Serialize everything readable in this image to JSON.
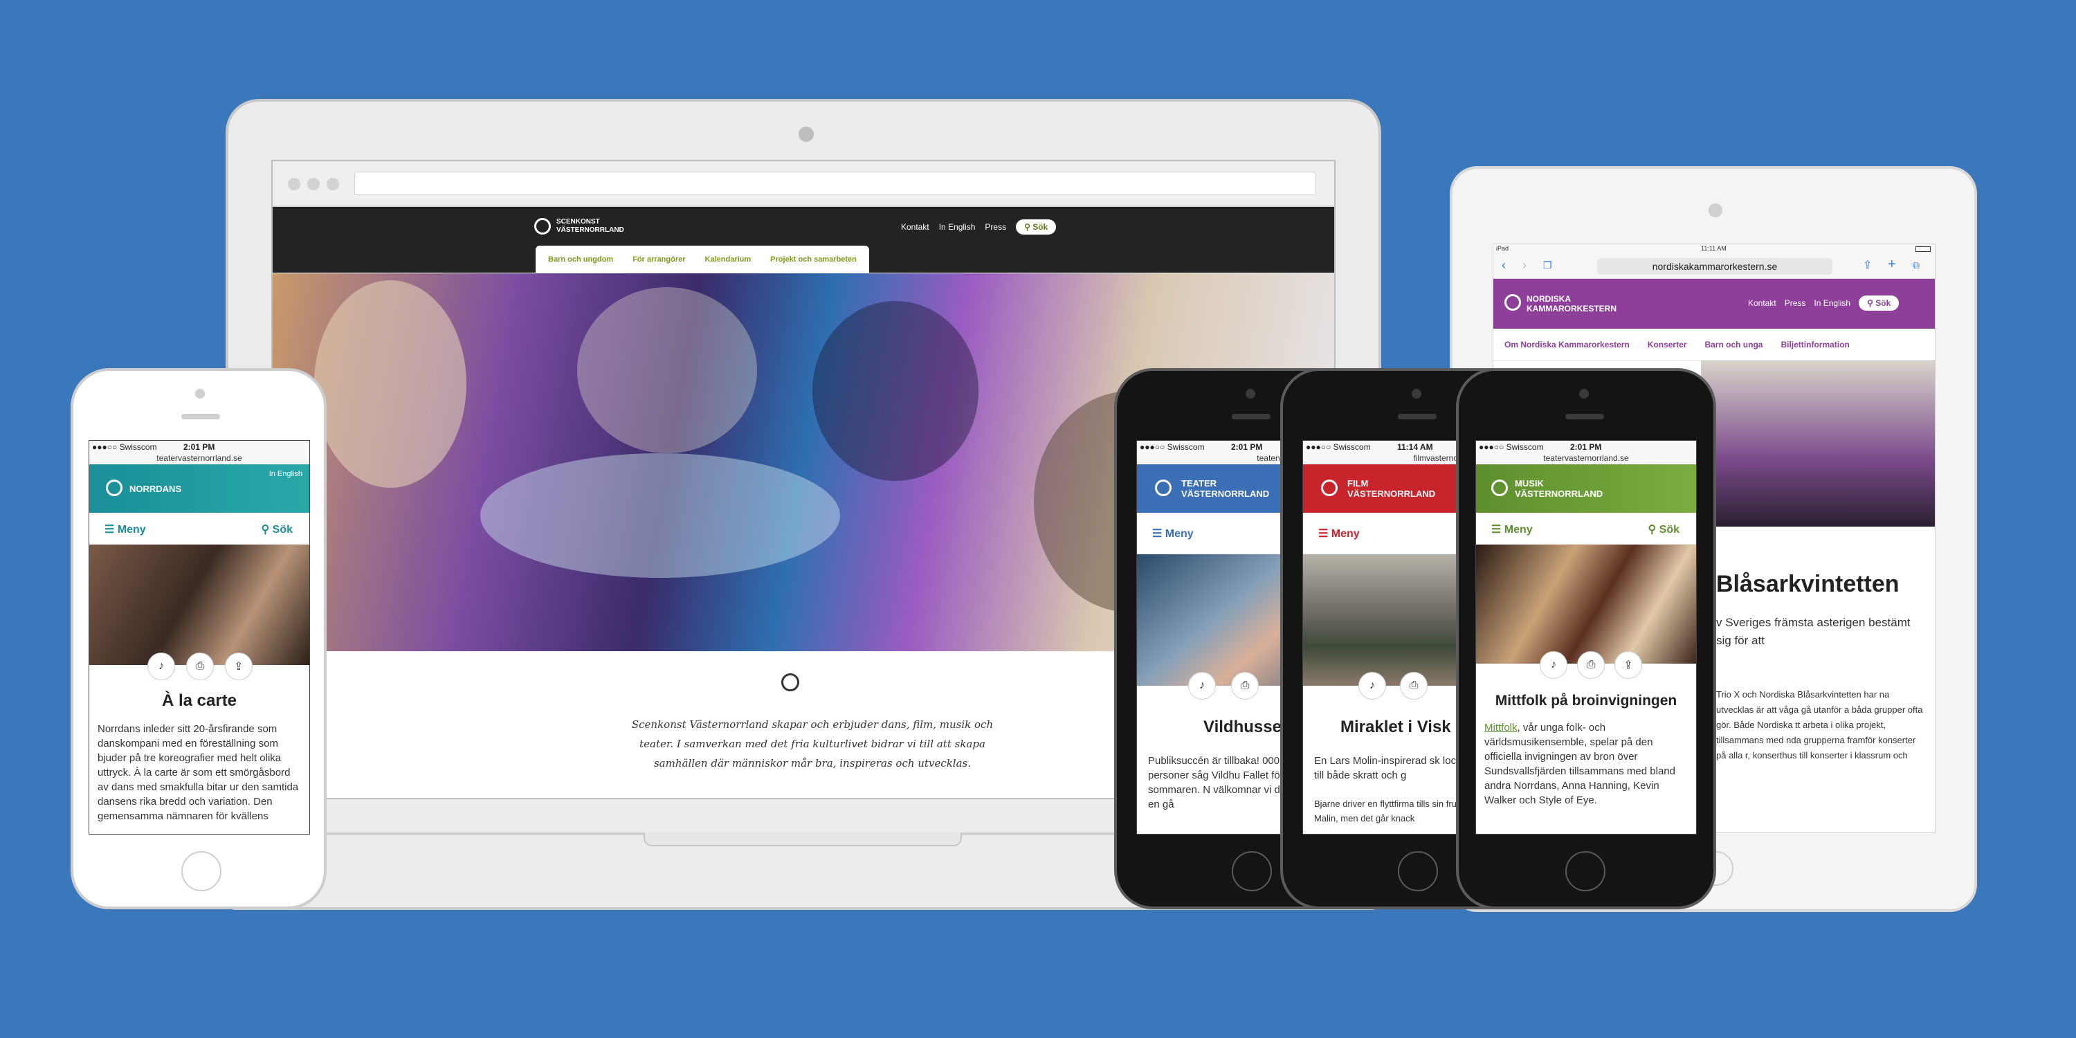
{
  "laptop": {
    "logo_line1": "SCENKONST",
    "logo_line2": "VÄSTERNORRLAND",
    "nav_links": [
      "Kontakt",
      "In English",
      "Press"
    ],
    "search_label": "Sök",
    "tabs": [
      "Barn och ungdom",
      "För arrangörer",
      "Kalendarium",
      "Projekt och samarbeten"
    ],
    "intro": "Scenkonst Västernorrland skapar och erbjuder dans, film, musik och teater. I samverkan med det fria kulturlivet bidrar vi till att skapa samhällen där människor mår bra, inspireras och utvecklas."
  },
  "tablet": {
    "device": "iPad",
    "time": "11:11 AM",
    "url": "nordiskakammarorkestern.se",
    "logo_line1": "NORDISKA",
    "logo_line2": "KAMMARORKESTERN",
    "nav_links": [
      "Kontakt",
      "Press",
      "In English"
    ],
    "search_label": "Sök",
    "tabs": [
      "Om Nordiska Kammarorkestern",
      "Konserter",
      "Barn och unga",
      "Biljettinformation"
    ],
    "title": "Blåsarkvintetten",
    "text": "v Sveriges främsta asterigen bestämt sig för att",
    "small": "Trio X och Nordiska Blåsarkvintetten har na utvecklas är att våga gå utanför a båda grupper ofta gör. Både Nordiska tt arbeta i olika projekt, tillsammans med nda grupperna framför konserter på alla r, konserthus till konserter i klassrum och"
  },
  "phone1": {
    "carrier": "●●●○○ Swisscom",
    "time": "2:01 PM",
    "url": "teatervasternorrland.se",
    "brand": "NORRDANS",
    "in_english": "In English",
    "menu": "Meny",
    "search": "Sök",
    "title": "À la carte",
    "text": "Norrdans inleder sitt 20-årsfirande som danskompani med en föreställning som bjuder på tre koreografier med helt olika uttryck. À la carte är som ett smörgåsbord av dans med smakfulla bitar ur den samtida dansens rika bredd och variation. Den gemensamma nämnaren för kvällens"
  },
  "phone2": {
    "carrier": "●●●○○ Swisscom",
    "time": "2:01 PM",
    "url": "teatervasternorrland.se",
    "brand_line1": "TEATER",
    "brand_line2": "VÄSTERNORRLAND",
    "menu": "Meny",
    "title": "Vildhussen",
    "text": "Publiksuccén är tillbaka! 000 personer såg Vildhu Fallet förra sommaren. N välkomnar vi dig än en gå"
  },
  "phone3": {
    "carrier": "●●●○○ Swisscom",
    "time": "11:14 AM",
    "url": "filmvasternorrland.se",
    "brand_line1": "FILM",
    "brand_line2": "VÄSTERNORRLAND",
    "menu": "Meny",
    "title": "Miraklet i Visk",
    "text": "En Lars Molin-inspirerad sk lockar till både skratt och g",
    "text2": "Bjarne driver en flyttfirma tills sin fru Malin, men det går knack"
  },
  "phone4": {
    "carrier": "●●●○○ Swisscom",
    "time": "2:01 PM",
    "url": "teatervasternorrland.se",
    "brand_line1": "MUSIK",
    "brand_line2": "VÄSTERNORRLAND",
    "menu": "Meny",
    "search": "Sök",
    "title": "Mittfolk på broinvigningen",
    "link": "Mittfolk",
    "text": ", vår unga folk- och världsmusikensemble, spelar på den officiella invigningen av bron över Sundsvallsfjärden tillsammans med bland andra Norrdans, Anna Hanning, Kevin Walker och Style of Eye."
  },
  "colors": {
    "background": "#3b78bb",
    "norrdans_teal": "#1a8f98",
    "teater_blue": "#3a6fb5",
    "film_red": "#c8242c",
    "musik_green": "#6a9a3a",
    "nk_purple": "#8e3f9a"
  }
}
